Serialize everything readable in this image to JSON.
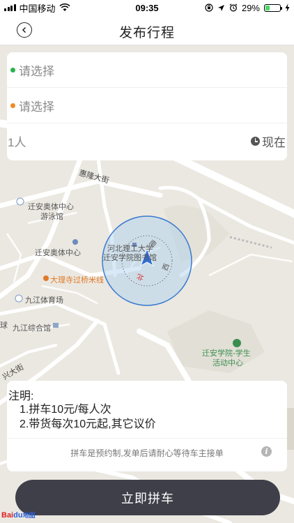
{
  "status_bar": {
    "carrier": "中国移动",
    "time": "09:35",
    "battery": "29%",
    "battery_level": 0.29
  },
  "nav": {
    "title": "发布行程",
    "back_icon": "chevron-left-circle-icon"
  },
  "trip_form": {
    "start_placeholder": "请选择",
    "end_placeholder": "请选择",
    "start_dot_color": "#2bb24c",
    "end_dot_color": "#f08a24",
    "people": "1人",
    "time": "现在"
  },
  "map": {
    "labels": {
      "road_huilong": "惠隆大街",
      "olympic_swim_1": "迁安奥体中心",
      "olympic_swim_2": "游泳馆",
      "olympic_center": "迁安奥体中心",
      "dali_temple": "大理寺过桥米线",
      "jiujiang_stadium": "九江体育场",
      "jiujiang_complex": "九江综合馆",
      "library_1": "河北理工大学",
      "library_2": "迁安学院图书馆",
      "student_center_1": "迁安学院-学生",
      "student_center_2": "活动中心",
      "compass_south": "南",
      "compass_west": "西",
      "compass_north": "北",
      "road_xing": "兴大街",
      "road_da": "大街",
      "road_qiu": "球"
    },
    "accuracy_circle_color": "#a8d0f0",
    "location_arrow_color": "#2f6fd6"
  },
  "notes": {
    "title": "注明:",
    "line1": "1.拼车10元/每人次",
    "line2": "2.带货每次10元起,其它议价",
    "hint": "拼车是预约制,发单后请耐心等待车主接单"
  },
  "submit_label": "立即拼车",
  "map_logo": {
    "bai": "Bai",
    "du": "du",
    "suffix": "地图"
  }
}
